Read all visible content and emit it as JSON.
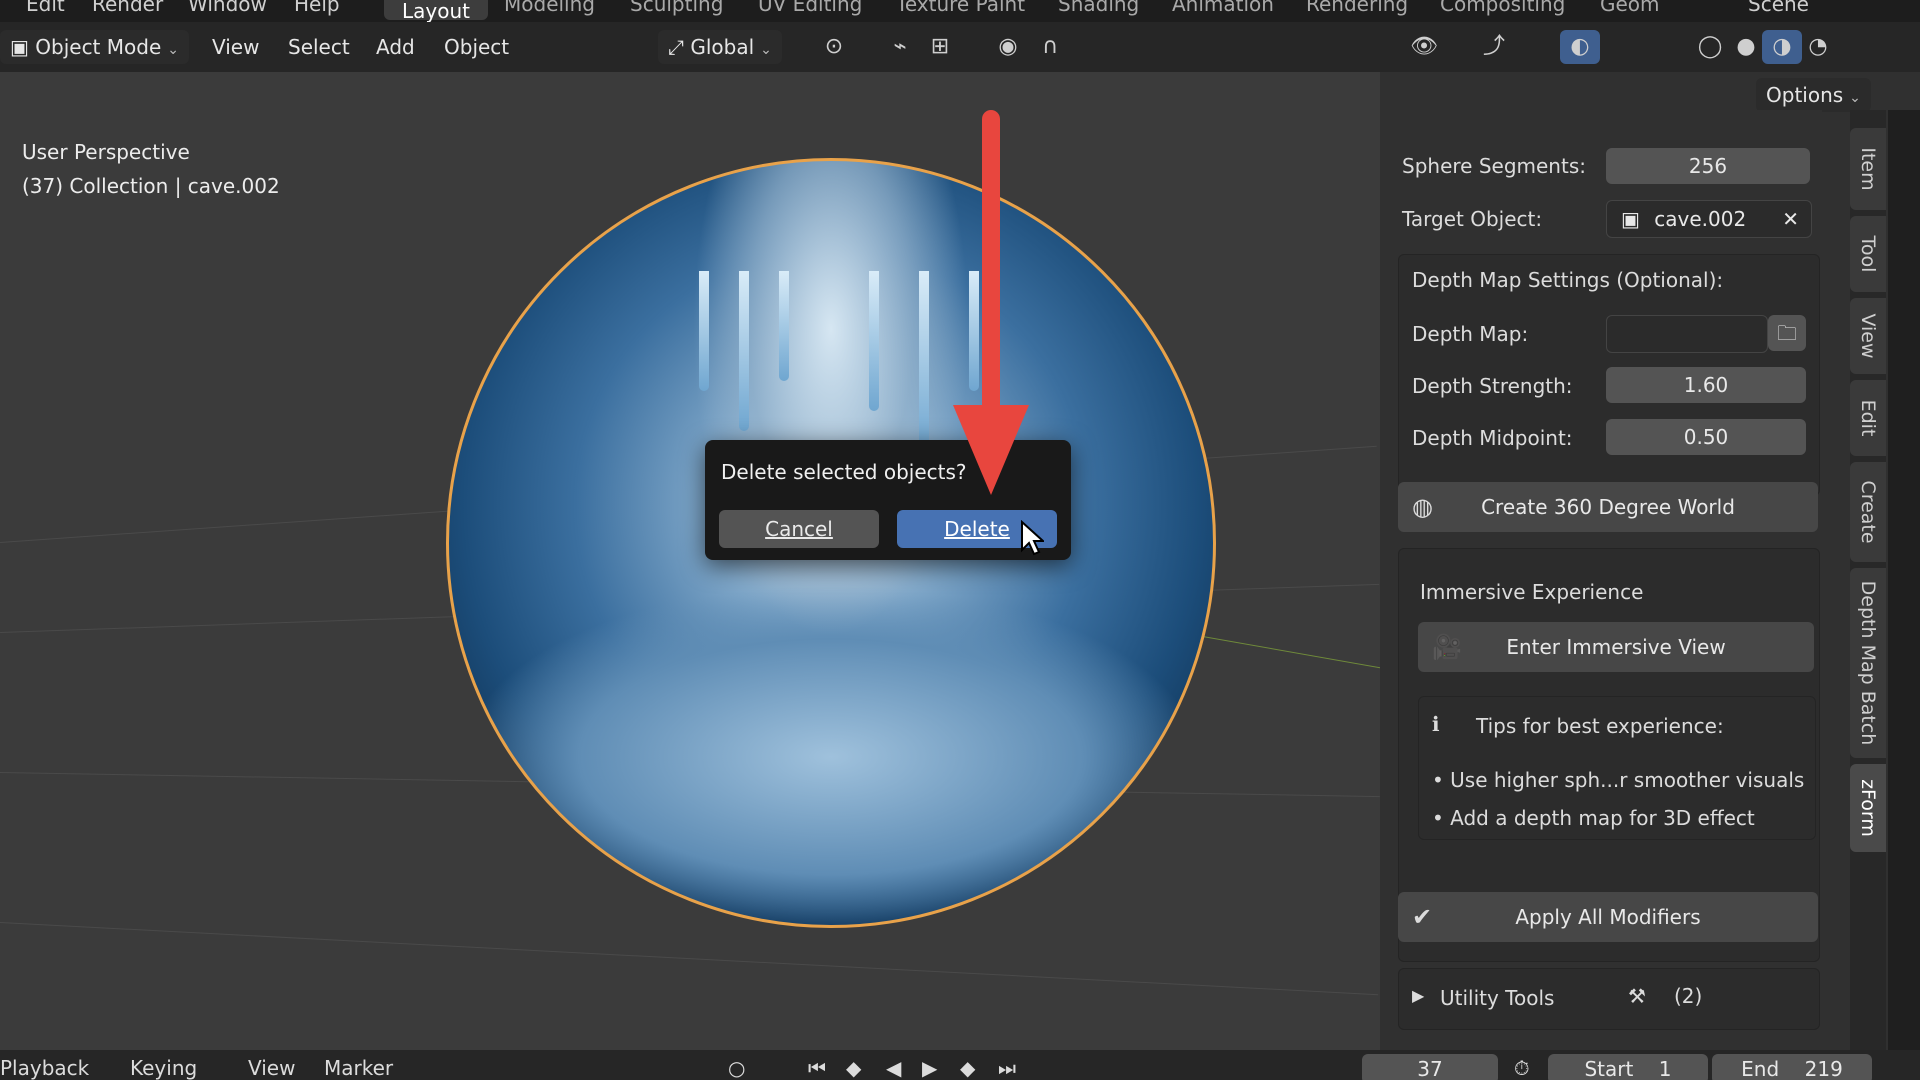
{
  "topbar": {
    "menus": [
      "Edit",
      "Render",
      "Window",
      "Help"
    ],
    "workspaces": [
      "Layout",
      "Modeling",
      "Sculpting",
      "UV Editing",
      "Texture Paint",
      "Shading",
      "Animation",
      "Rendering",
      "Compositing",
      "Geom"
    ],
    "active_workspace": "Layout",
    "scene_label": "Scene"
  },
  "header": {
    "mode_label": "Object Mode",
    "menus": [
      "View",
      "Select",
      "Add",
      "Object"
    ],
    "transform_orientation": "Global",
    "options_label": "Options"
  },
  "viewport": {
    "view_name": "User Perspective",
    "collection_info": "(37) Collection | cave.002"
  },
  "dialog": {
    "title": "Delete selected objects?",
    "cancel_label": "Cancel",
    "delete_label": "Delete"
  },
  "panel": {
    "sphere_segments_label": "Sphere Segments:",
    "sphere_segments_value": "256",
    "target_object_label": "Target Object:",
    "target_object_value": "cave.002",
    "depth_header": "Depth Map Settings (Optional):",
    "depth_map_label": "Depth Map:",
    "depth_map_value": "",
    "depth_strength_label": "Depth Strength:",
    "depth_strength_value": "1.60",
    "depth_midpoint_label": "Depth Midpoint:",
    "depth_midpoint_value": "0.50",
    "create_world_label": "Create 360 Degree World",
    "immersive_header": "Immersive Experience",
    "enter_immersive_label": "Enter Immersive View",
    "tips_header": "Tips for best experience:",
    "tip_1": "• Use higher sph...r smoother visuals",
    "tip_2": "• Add a depth map for 3D effect",
    "apply_modifiers_label": "Apply All Modifiers",
    "utility_tools_label": "Utility Tools",
    "utility_count": "(2)"
  },
  "vtabs": [
    "Item",
    "Tool",
    "View",
    "Edit",
    "Create",
    "Depth Map Batch",
    "zForm"
  ],
  "active_vtab": "zForm",
  "timeline": {
    "playback_label": "Playback",
    "keying_label": "Keying",
    "view_label": "View",
    "marker_label": "Marker",
    "current_frame": "37",
    "start_label": "Start",
    "start_value": "1",
    "end_label": "End",
    "end_value": "219"
  },
  "colors": {
    "selection_outline": "#e8a24a",
    "delete_button": "#4772b3",
    "annotation_arrow": "#e8463e"
  }
}
